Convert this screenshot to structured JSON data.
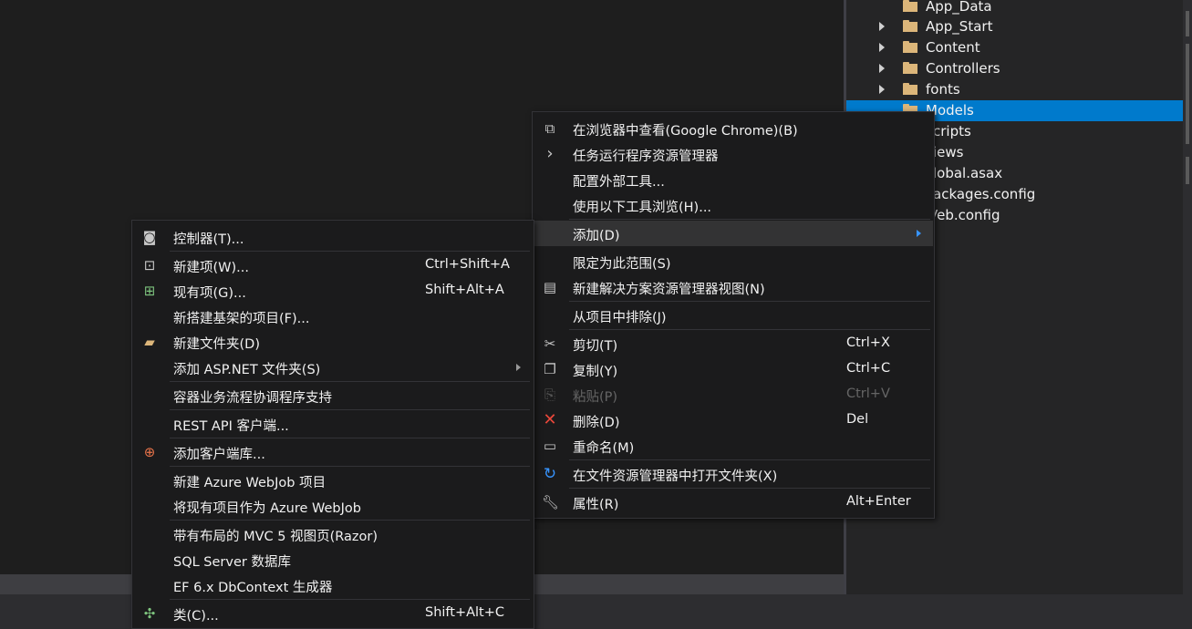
{
  "explorer": {
    "items": [
      {
        "label": "App_Data",
        "expandable": false
      },
      {
        "label": "App_Start",
        "expandable": true
      },
      {
        "label": "Content",
        "expandable": true
      },
      {
        "label": "Controllers",
        "expandable": true
      },
      {
        "label": "fonts",
        "expandable": true
      },
      {
        "label": "Models",
        "expandable": false,
        "selected": true
      },
      {
        "label": "cripts"
      },
      {
        "label": "iews"
      },
      {
        "label": "lobal.asax"
      },
      {
        "label": "ackages.config"
      },
      {
        "label": "Veb.config"
      }
    ]
  },
  "main_menu": {
    "items": [
      {
        "label": "在浏览器中查看(Google Chrome)(B)",
        "icon": "browser-icon"
      },
      {
        "label": "任务运行程序资源管理器",
        "icon": "chevron-right-icon"
      },
      {
        "label": "配置外部工具..."
      },
      {
        "label": "使用以下工具浏览(H)..."
      },
      {
        "label": "添加(D)",
        "submenu": true
      },
      {
        "label": "限定为此范围(S)"
      },
      {
        "label": "新建解决方案资源管理器视图(N)",
        "icon": "new-view-icon"
      },
      {
        "label": "从项目中排除(J)"
      },
      {
        "label": "剪切(T)",
        "shortcut": "Ctrl+X",
        "icon": "cut-icon"
      },
      {
        "label": "复制(Y)",
        "shortcut": "Ctrl+C",
        "icon": "copy-icon"
      },
      {
        "label": "粘贴(P)",
        "shortcut": "Ctrl+V",
        "icon": "paste-icon",
        "disabled": true
      },
      {
        "label": "删除(D)",
        "shortcut": "Del",
        "icon": "delete-icon"
      },
      {
        "label": "重命名(M)",
        "icon": "rename-icon"
      },
      {
        "label": "在文件资源管理器中打开文件夹(X)",
        "icon": "refresh-arrow-icon"
      },
      {
        "label": "属性(R)",
        "shortcut": "Alt+Enter",
        "icon": "wrench-icon"
      }
    ]
  },
  "add_menu": {
    "items": [
      {
        "label": "控制器(T)...",
        "icon": "controller-icon"
      },
      {
        "label": "新建项(W)...",
        "shortcut": "Ctrl+Shift+A",
        "icon": "new-item-icon"
      },
      {
        "label": "现有项(G)...",
        "shortcut": "Shift+Alt+A",
        "icon": "existing-item-icon"
      },
      {
        "label": "新搭建基架的项目(F)..."
      },
      {
        "label": "新建文件夹(D)",
        "icon": "new-folder-icon"
      },
      {
        "label": "添加 ASP.NET 文件夹(S)",
        "submenu": true
      },
      {
        "label": "容器业务流程协调程序支持"
      },
      {
        "label": "REST API 客户端..."
      },
      {
        "label": "添加客户端库...",
        "icon": "client-library-icon"
      },
      {
        "label": "新建 Azure WebJob 项目"
      },
      {
        "label": "将现有项目作为 Azure WebJob"
      },
      {
        "label": "带有布局的 MVC 5 视图页(Razor)"
      },
      {
        "label": "SQL Server 数据库"
      },
      {
        "label": "EF 6.x DbContext 生成器"
      },
      {
        "label": "类(C)...",
        "shortcut": "Shift+Alt+C",
        "icon": "class-icon"
      }
    ]
  },
  "colors": {
    "selection": "#007acc",
    "folder": "#dcb67a",
    "delete": "#e8473a",
    "accent_blue": "#3794ff"
  }
}
